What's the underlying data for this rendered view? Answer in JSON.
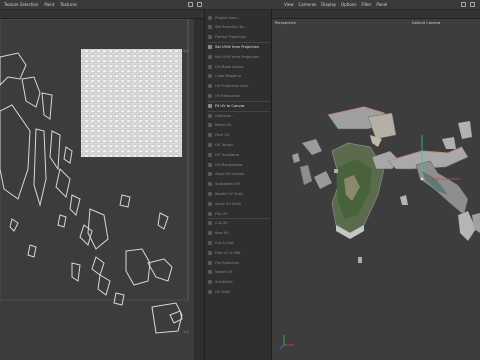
{
  "menubar": {
    "left_menu": [
      "Texture Selection",
      "Paint",
      "Textures"
    ],
    "right_menu": [
      "View",
      "Cameras",
      "Display",
      "Options",
      "Filter",
      "Panel"
    ]
  },
  "uv_editor": {
    "corner_labels": [
      "1,0",
      "1,0",
      "0,0"
    ]
  },
  "tool_panel": {
    "items": [
      {
        "label": "Project from...",
        "highlight": false
      },
      {
        "label": "Set Selection to...",
        "highlight": false
      },
      {
        "label": "Frontal Projection",
        "highlight": false
      },
      {
        "label": "Set UVW from Projection",
        "highlight": true
      },
      {
        "label": "Set UVW from Projection",
        "highlight": false
      },
      {
        "label": "UV Mode Adjust",
        "highlight": false
      },
      {
        "label": "Cube Mapping",
        "highlight": false
      },
      {
        "label": "UV Projection Lock",
        "highlight": false
      },
      {
        "label": "UV Relaxation",
        "highlight": false
      },
      {
        "label": "Fit UV to Canvas",
        "highlight": true
      },
      {
        "label": "Optimize...",
        "highlight": false
      },
      {
        "label": "Relax UV",
        "highlight": false
      },
      {
        "label": "Pack UV",
        "highlight": false
      },
      {
        "label": "UV Terrain",
        "highlight": false
      },
      {
        "label": "UV Transform",
        "highlight": false
      },
      {
        "label": "UV Manipulator",
        "highlight": false
      },
      {
        "label": "Align UV Islands",
        "highlight": false
      },
      {
        "label": "Straighten UV",
        "highlight": false
      },
      {
        "label": "Rotate UV Shell",
        "highlight": false
      },
      {
        "label": "Scale UV Shell",
        "highlight": false
      },
      {
        "label": "Flip UV",
        "highlight": false
      },
      {
        "label": "Cut UV",
        "highlight": false
      },
      {
        "label": "Sew UV",
        "highlight": false
      },
      {
        "label": "Cut & Sew",
        "highlight": false
      },
      {
        "label": "Fold UV & Edit",
        "highlight": false
      },
      {
        "label": "Flip Selection",
        "highlight": false
      },
      {
        "label": "Select UV",
        "highlight": false
      },
      {
        "label": "Subdivide",
        "highlight": false
      },
      {
        "label": "UV Shell",
        "highlight": false
      }
    ]
  },
  "viewport": {
    "view_name": "Perspective",
    "camera": "Default Camera"
  }
}
